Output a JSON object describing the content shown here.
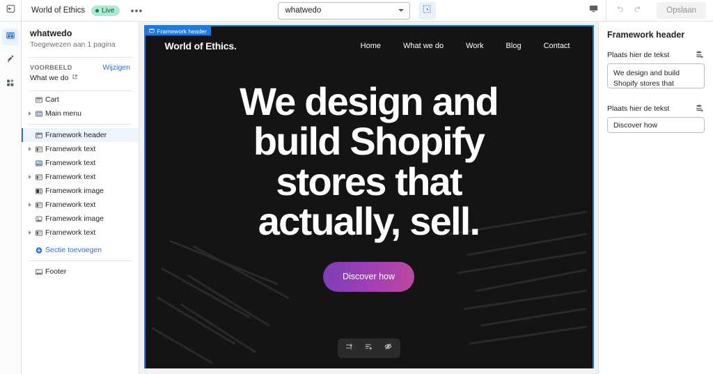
{
  "topbar": {
    "exit_icon": "exit-icon",
    "store_name": "World of Ethics",
    "status_badge": "Live",
    "more_icon": "ellipsis-icon",
    "page_selector": {
      "value": "whatwedo",
      "caret_icon": "chevron-down-icon"
    },
    "inspector_icon": "inspector-select-icon",
    "preview_icon": "desktop-preview-icon",
    "undo_icon": "undo-icon",
    "redo_icon": "redo-icon",
    "save_label": "Opslaan"
  },
  "rail": {
    "items": [
      {
        "name": "sections-icon",
        "active": true
      },
      {
        "name": "theme-settings-icon",
        "active": false
      },
      {
        "name": "app-blocks-icon",
        "active": false
      }
    ]
  },
  "sidebar": {
    "template_name": "whatwedo",
    "assigned_text": "Toegewezen aan 1 pagina",
    "preview_label": "VOORBEELD",
    "change_link": "Wijzigen",
    "preview_page": "What we do",
    "external_icon": "external-link-icon",
    "tree": [
      {
        "label": "Cart",
        "icon": "cart-section-icon",
        "expandable": false,
        "selected": false,
        "group": "top"
      },
      {
        "label": "Main menu",
        "icon": "main-menu-icon",
        "expandable": true,
        "selected": false,
        "group": "top"
      },
      {
        "label": "Framework header",
        "icon": "header-section-icon",
        "expandable": false,
        "selected": true,
        "group": "body"
      },
      {
        "label": "Framework text",
        "icon": "text-section-icon",
        "expandable": true,
        "selected": false,
        "group": "body"
      },
      {
        "label": "Framework text",
        "icon": "image-text-section-icon",
        "expandable": false,
        "selected": false,
        "group": "body"
      },
      {
        "label": "Framework text",
        "icon": "text-section-icon",
        "expandable": true,
        "selected": false,
        "group": "body"
      },
      {
        "label": "Framework image",
        "icon": "image-section-icon",
        "expandable": false,
        "selected": false,
        "group": "body"
      },
      {
        "label": "Framework text",
        "icon": "text-section-icon",
        "expandable": true,
        "selected": false,
        "group": "body"
      },
      {
        "label": "Framework image",
        "icon": "picture-section-icon",
        "expandable": false,
        "selected": false,
        "group": "body"
      },
      {
        "label": "Framework text",
        "icon": "text-section-icon",
        "expandable": true,
        "selected": false,
        "group": "body"
      }
    ],
    "add_section_label": "Sectie toevoegen",
    "add_section_icon": "plus-circle-icon",
    "footer_label": "Footer",
    "footer_icon": "footer-section-icon"
  },
  "preview": {
    "section_tag": "Framework header",
    "section_tag_icon": "header-section-icon",
    "site": {
      "brand": "World of Ethics.",
      "nav": [
        "Home",
        "What we do",
        "Work",
        "Blog",
        "Contact"
      ],
      "heading": "We design and build Shopify stores that actually, sell.",
      "cta_label": "Discover how",
      "cta_gradient_from": "#7b3fb5",
      "cta_gradient_to": "#c0479f",
      "background": "#141414"
    },
    "block_toolbar": [
      {
        "name": "reorder-block-icon"
      },
      {
        "name": "add-block-icon"
      },
      {
        "name": "hide-block-icon"
      }
    ]
  },
  "right_panel": {
    "title": "Framework header",
    "fields": [
      {
        "label": "Plaats hier de tekst",
        "value": "We design and build Shopify stores that actually, sell.",
        "dynamic_icon": "dynamic-source-icon",
        "multiline": true
      },
      {
        "label": "Plaats hier de tekst",
        "value": "Discover how",
        "dynamic_icon": "dynamic-source-icon",
        "multiline": false
      }
    ]
  }
}
